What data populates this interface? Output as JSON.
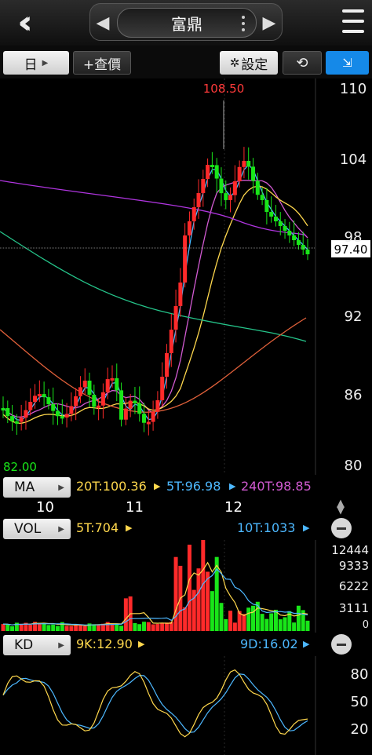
{
  "header": {
    "back_icon": "double-chevron-left-icon",
    "stock_name": "富鼎",
    "menu_icon": "hamburger-icon"
  },
  "toolbar": {
    "period_label": "日",
    "add_quote_label": "+查價",
    "settings_label": "設定",
    "settings_icon": "gear-icon",
    "rotate_icon": "rotate-icon",
    "collapse_icon": "collapse-arrows-icon"
  },
  "price": {
    "high_label": "108.50",
    "low_label": "82.00",
    "current_label": "97.40",
    "y_ticks": [
      "110",
      "104",
      "98",
      "92",
      "86",
      "80"
    ]
  },
  "ma": {
    "label": "MA",
    "ma20": "20T:100.36",
    "ma5": "5T:96.98",
    "ma240": "240T:98.85"
  },
  "dates": [
    "10",
    "11",
    "12"
  ],
  "vol": {
    "label": "VOL",
    "ma5": "5T:704",
    "ma10": "10T:1033",
    "ticks": [
      "12444",
      "9333",
      "6222",
      "3111",
      "0"
    ]
  },
  "kd": {
    "label": "KD",
    "k": "9K:12.90",
    "d": "9D:16.02",
    "ticks": [
      "80",
      "50",
      "20"
    ]
  },
  "colors": {
    "up": "#ff2a2a",
    "down": "#19e619",
    "ma5": "#4db8ff",
    "ma20": "#ffd84d",
    "ma60": "#d15ad1",
    "ma_long": "#b035e0",
    "ma120": "#25c48a",
    "ma240": "#e0603a",
    "k": "#ffd84d",
    "d": "#4db8ff",
    "accent": "#1589e8"
  }
}
